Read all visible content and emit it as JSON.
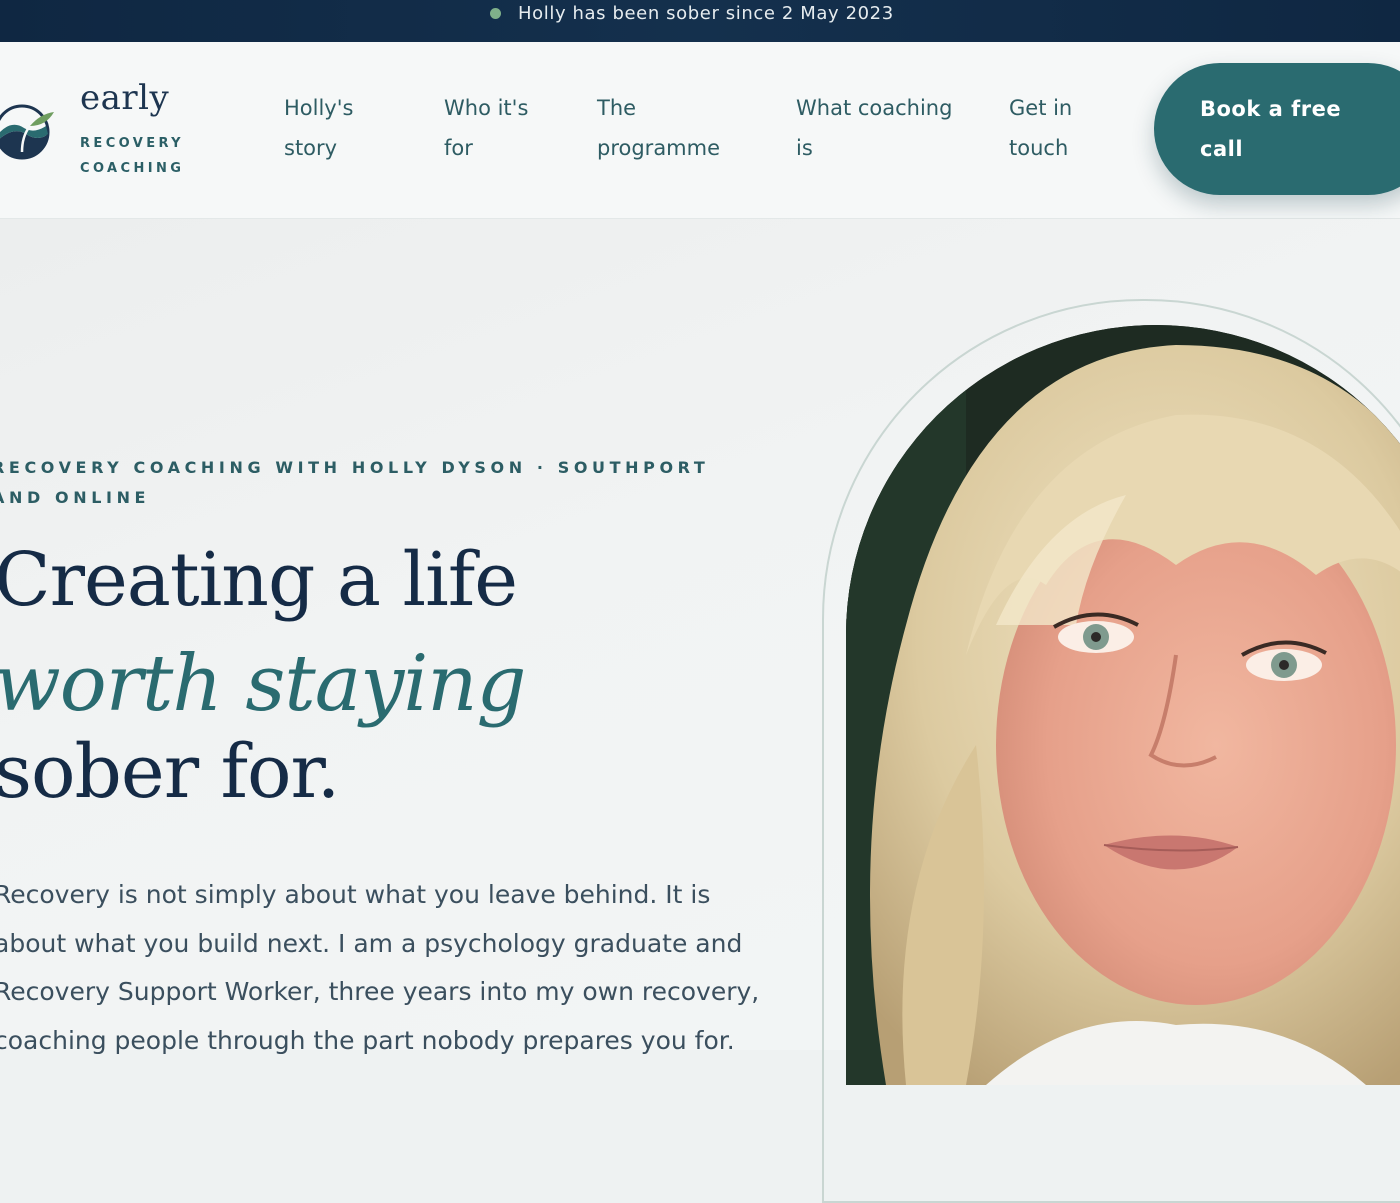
{
  "announcement": {
    "text": "Holly has been sober since 2 May 2023"
  },
  "brand": {
    "word": "early",
    "sub_line1": "RECOVERY",
    "sub_line2": "COACHING"
  },
  "nav": [
    {
      "line1": "Holly's",
      "line2": "story"
    },
    {
      "line1": "Who it's",
      "line2": "for"
    },
    {
      "line1": "The",
      "line2": "programme"
    },
    {
      "line1": "What coaching",
      "line2": "is"
    },
    {
      "line1": "Get in",
      "line2": "touch"
    }
  ],
  "cta": {
    "label": "Book a free call"
  },
  "hero": {
    "eyebrow": "RECOVERY COACHING WITH HOLLY DYSON · SOUTHPORT AND ONLINE",
    "headline_line1": "Creating a life",
    "headline_script": "worth staying",
    "headline_line3": "sober for.",
    "body": "Recovery is not simply about what you leave behind. It is about what you build next. I am a psychology graduate and Recovery Support Worker, three years into my own recovery, coaching people through the part nobody prepares you for."
  },
  "colors": {
    "topbar": "#0f2742",
    "accent": "#2a6b70",
    "heading": "#152b46",
    "status_dot": "#7fb08a"
  }
}
